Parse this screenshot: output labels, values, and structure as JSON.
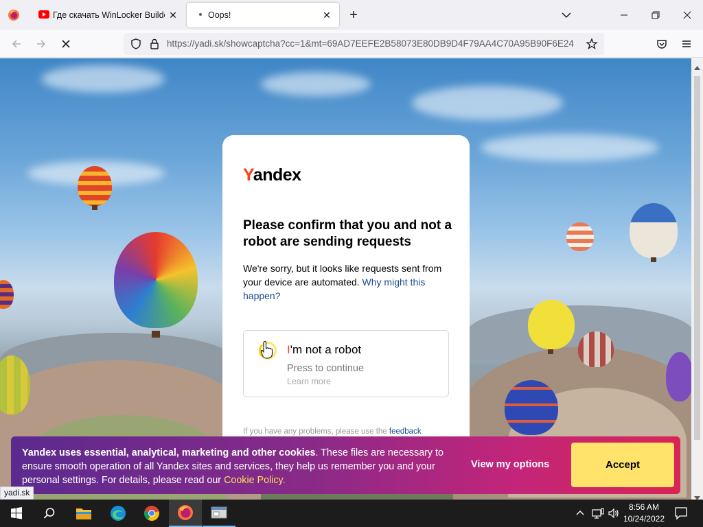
{
  "browser": {
    "tabs": [
      {
        "title": "Где скачать WinLocker Builder",
        "icon": "youtube-icon",
        "active": false
      },
      {
        "title": "Oops!",
        "icon": "loading-dot-icon",
        "active": true
      }
    ],
    "url_full": "https://yadi.sk/showcaptcha?cc=1&mt=69AD7EEFE2B58073E80DB9D4F79AA4C70A95B90F6E24",
    "url_host": "https://yadi.sk",
    "url_rest": "/showcaptcha?cc=1&mt=69AD7EEFE2B58073E80DB9D4F79AA4C70A95B90F6E24",
    "status_link": "yadi.sk"
  },
  "captcha": {
    "logo_first": "Y",
    "logo_rest": "andex",
    "heading": "Please confirm that you and not a robot are sending requests",
    "sorry_text": "We're sorry, but it looks like requests sent from your device are automated.",
    "why_link": "Why might this happen?",
    "robot_first": "I",
    "robot_rest": "'m not a robot",
    "press_continue": "Press to continue",
    "learn_more": "Learn more",
    "problems_text": "If you have any problems, please use the",
    "feedback_link": "feedback"
  },
  "cookie": {
    "bold_text": "Yandex uses essential, analytical, marketing and other cookies",
    "body_text": ". These files are necessary to ensure smooth operation of all Yandex sites and services, they help us remember you and your personal settings. For details, please read our",
    "policy_link": "Cookie Policy.",
    "view_options": "View my options",
    "accept": "Accept"
  },
  "taskbar": {
    "apps": [
      "windows-start-icon",
      "search-icon",
      "file-explorer-icon",
      "edge-icon",
      "chrome-icon",
      "firefox-icon",
      "app-window-icon"
    ],
    "time": "8:56 AM",
    "date": "10/24/2022"
  },
  "colors": {
    "yandex_red": "#fc3f1d",
    "link_blue": "#1a4a8a",
    "accept_yellow": "#ffe36b",
    "cookie_gradient_start": "#5b2a8f",
    "cookie_gradient_end": "#d92555"
  }
}
